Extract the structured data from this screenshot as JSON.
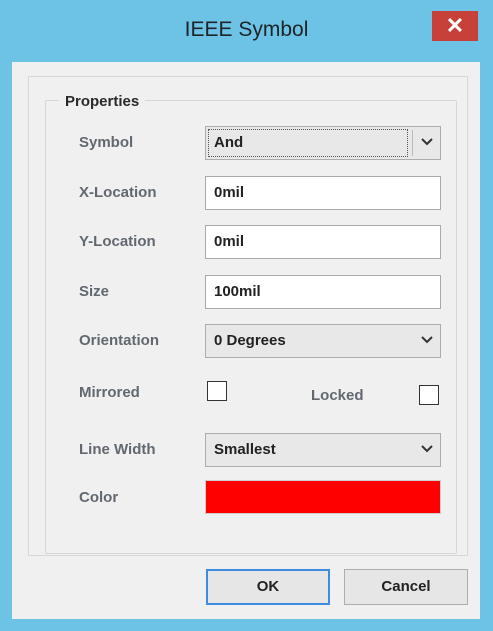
{
  "window": {
    "title": "IEEE Symbol",
    "close_glyph": "✕"
  },
  "group": {
    "title": "Properties"
  },
  "fields": {
    "symbol": {
      "label": "Symbol",
      "value": "And"
    },
    "x_location": {
      "label": "X-Location",
      "value": "0mil"
    },
    "y_location": {
      "label": "Y-Location",
      "value": "0mil"
    },
    "size": {
      "label": "Size",
      "value": "100mil"
    },
    "orientation": {
      "label": "Orientation",
      "value": "0 Degrees"
    },
    "mirrored": {
      "label": "Mirrored",
      "checked": false
    },
    "locked": {
      "label": "Locked",
      "checked": false
    },
    "line_width": {
      "label": "Line Width",
      "value": "Smallest"
    },
    "color": {
      "label": "Color",
      "value": "#ff0000"
    }
  },
  "buttons": {
    "ok": "OK",
    "cancel": "Cancel"
  }
}
